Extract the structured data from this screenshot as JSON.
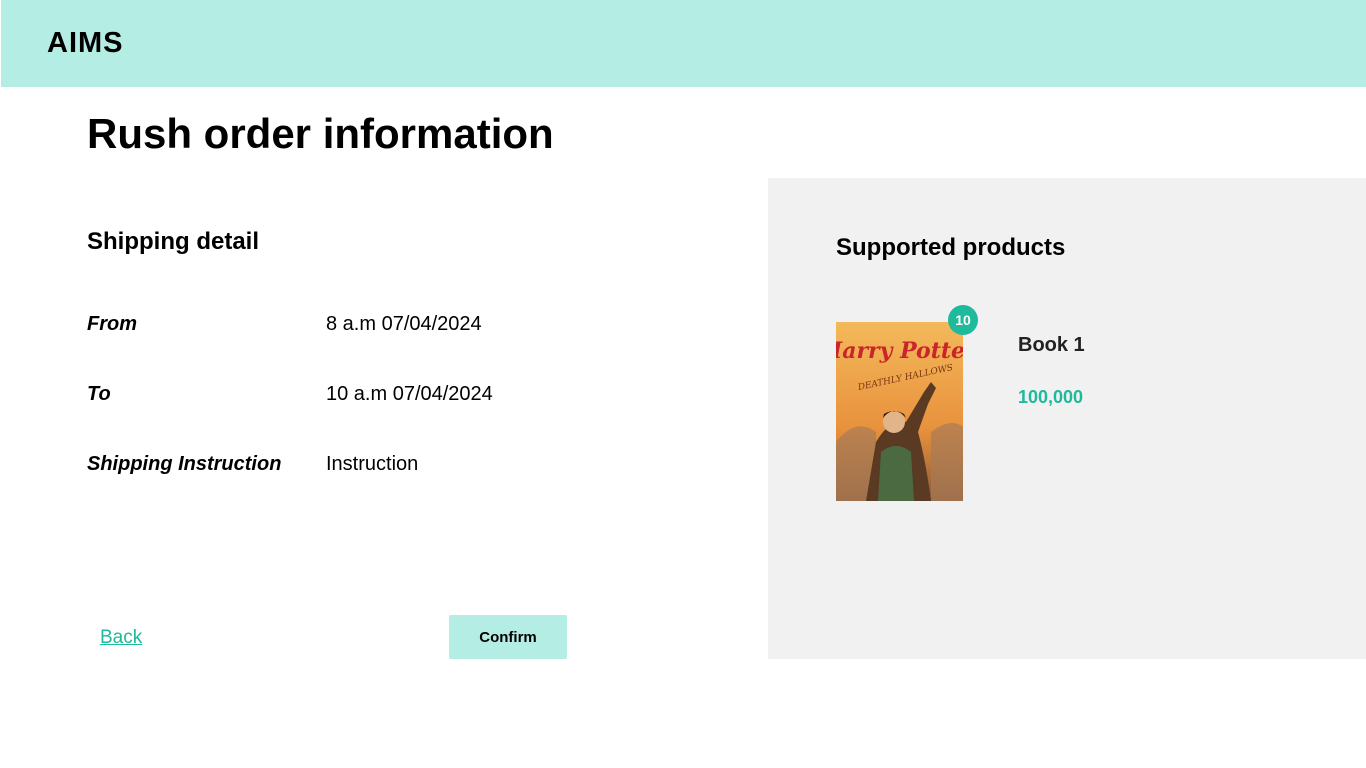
{
  "header": {
    "brand": "AIMS"
  },
  "page": {
    "title": "Rush order information"
  },
  "shipping": {
    "title": "Shipping detail",
    "rows": [
      {
        "label": "From",
        "value": "8 a.m 07/04/2024"
      },
      {
        "label": "To",
        "value": "10 a.m 07/04/2024"
      },
      {
        "label": "Shipping Instruction",
        "value": "Instruction"
      }
    ]
  },
  "actions": {
    "back_label": "Back",
    "confirm_label": "Confirm"
  },
  "products": {
    "title": "Supported products",
    "items": [
      {
        "name": "Book 1",
        "price": "100,000",
        "quantity": "10",
        "cover_title": "Harry Potter",
        "cover_subtitle": "DEATHLY HALLOWS"
      }
    ]
  },
  "colors": {
    "header_bg": "#b4ede3",
    "accent": "#1fb99b",
    "panel_bg": "#f1f1f1"
  }
}
